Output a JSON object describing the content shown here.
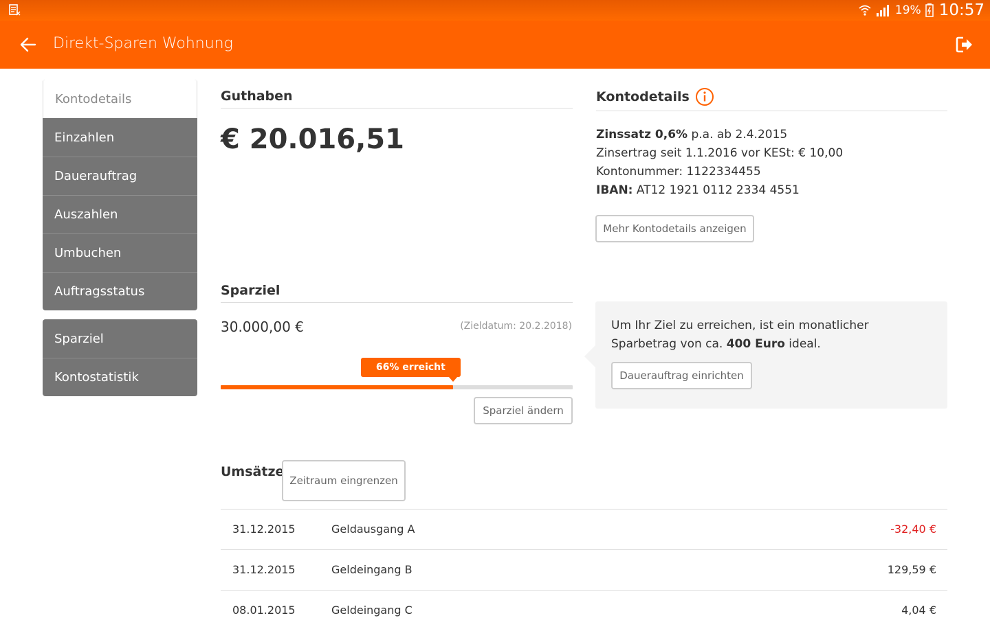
{
  "status_bar": {
    "battery_percent": "19%",
    "time": "10:57"
  },
  "app_bar": {
    "title": "Direkt-Sparen Wohnung"
  },
  "sidebar": {
    "group1": [
      {
        "label": "Kontodetails",
        "active": true
      },
      {
        "label": "Einzahlen"
      },
      {
        "label": "Dauerauftrag"
      },
      {
        "label": "Auszahlen"
      },
      {
        "label": "Umbuchen"
      },
      {
        "label": "Auftragsstatus"
      }
    ],
    "group2": [
      {
        "label": "Sparziel"
      },
      {
        "label": "Kontostatistik"
      }
    ]
  },
  "guthaben": {
    "title": "Guthaben",
    "balance": "€ 20.016,51"
  },
  "kontodetails": {
    "title": "Kontodetails",
    "zinssatz_label": "Zinssatz 0,6%",
    "zinssatz_rest": " p.a. ab 2.4.2015",
    "zinsertrag": "Zinsertrag seit 1.1.2016 vor KESt: € 10,00",
    "kontonummer": "Kontonummer: 1122334455",
    "iban_label": "IBAN:",
    "iban_value": " AT12 1921 0112 2334 4551",
    "more_button": "Mehr Kontodetails anzeigen"
  },
  "sparziel": {
    "title": "Sparziel",
    "amount": "30.000,00  €",
    "target_date": "(Zieldatum: 20.2.2018)",
    "progress_percent": 66,
    "progress_label": "66% erreicht",
    "change_button": "Sparziel ändern"
  },
  "tip": {
    "text_before": "Um Ihr Ziel zu erreichen, ist ein monatlicher Sparbetrag von ca. ",
    "text_bold": "400 Euro",
    "text_after": " ideal.",
    "button": "Dauerauftrag einrichten"
  },
  "umsaetze": {
    "title": "Umsätze",
    "filter_button": "Zeitraum eingrenzen",
    "rows": [
      {
        "date": "31.12.2015",
        "description": "Geldausgang A",
        "amount": "-32,40 €",
        "negative": true
      },
      {
        "date": "31.12.2015",
        "description": "Geldeingang B",
        "amount": "129,59 €",
        "negative": false
      },
      {
        "date": "08.01.2015",
        "description": "Geldeingang C",
        "amount": "4,04 €",
        "negative": false
      }
    ]
  },
  "colors": {
    "accent": "#ff6200",
    "sidebar": "#757575",
    "negative": "#e02020"
  }
}
